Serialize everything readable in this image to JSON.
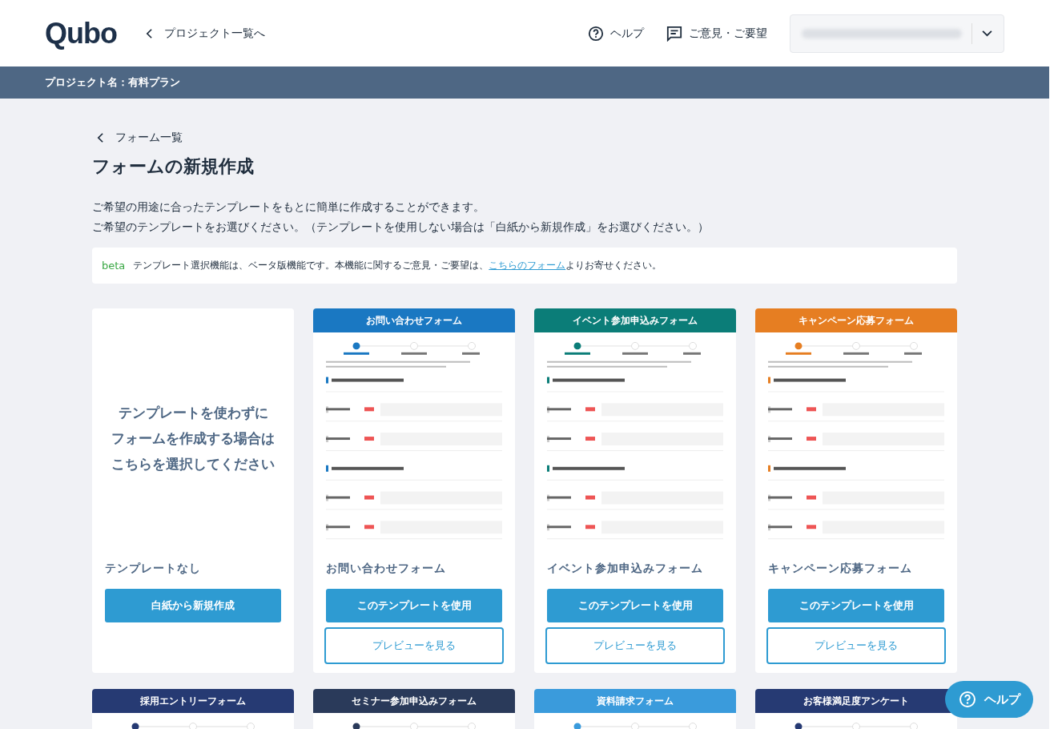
{
  "header": {
    "logo": "Qubo",
    "back_link": "プロジェクト一覧へ",
    "help": "ヘルプ",
    "feedback": "ご意見・ご要望"
  },
  "project_bar": "プロジェクト名：有料プラン",
  "breadcrumb": "フォーム一覧",
  "title": "フォームの新規作成",
  "intro": [
    "ご希望の用途に合ったテンプレートをもとに簡単に作成することができます。",
    "ご希望のテンプレートをお選びください。（テンプレートを使用しない場合は「白紙から新規作成」をお選びください。）"
  ],
  "notice": {
    "tag": "beta",
    "text_before": "テンプレート選択機能は、ベータ版機能です。本機能に関するご意見・ご要望は、",
    "link": "こちらのフォーム",
    "text_after": "よりお寄せください。"
  },
  "templates": [
    {
      "kind": "blank",
      "message": [
        "テンプレートを使わずに",
        "フォームを作成する場合は",
        "こちらを選択してください"
      ],
      "name": "テンプレートなし",
      "primary_button": "白紙から新規作成"
    },
    {
      "kind": "template",
      "header": "お問い合わせフォーム",
      "color": "#1a78c2",
      "name": "お問い合わせフォーム",
      "primary_button": "このテンプレートを使用",
      "secondary_button": "プレビューを見る"
    },
    {
      "kind": "template",
      "header": "イベント参加申込みフォーム",
      "color": "#0b7d78",
      "name": "イベント参加申込みフォーム",
      "primary_button": "このテンプレートを使用",
      "secondary_button": "プレビューを見る"
    },
    {
      "kind": "template",
      "header": "キャンペーン応募フォーム",
      "color": "#e67e22",
      "name": "キャンペーン応募フォーム",
      "primary_button": "このテンプレートを使用",
      "secondary_button": "プレビューを見る"
    }
  ],
  "more_templates": [
    {
      "header": "採用エントリーフォーム",
      "color": "#263a73"
    },
    {
      "header": "セミナー参加申込みフォーム",
      "color": "#2a3a5a"
    },
    {
      "header": "資料請求フォーム",
      "color": "#3a9bdc"
    },
    {
      "header": "お客様満足度アンケート",
      "color": "#263a73"
    }
  ],
  "help_button": "ヘルプ"
}
